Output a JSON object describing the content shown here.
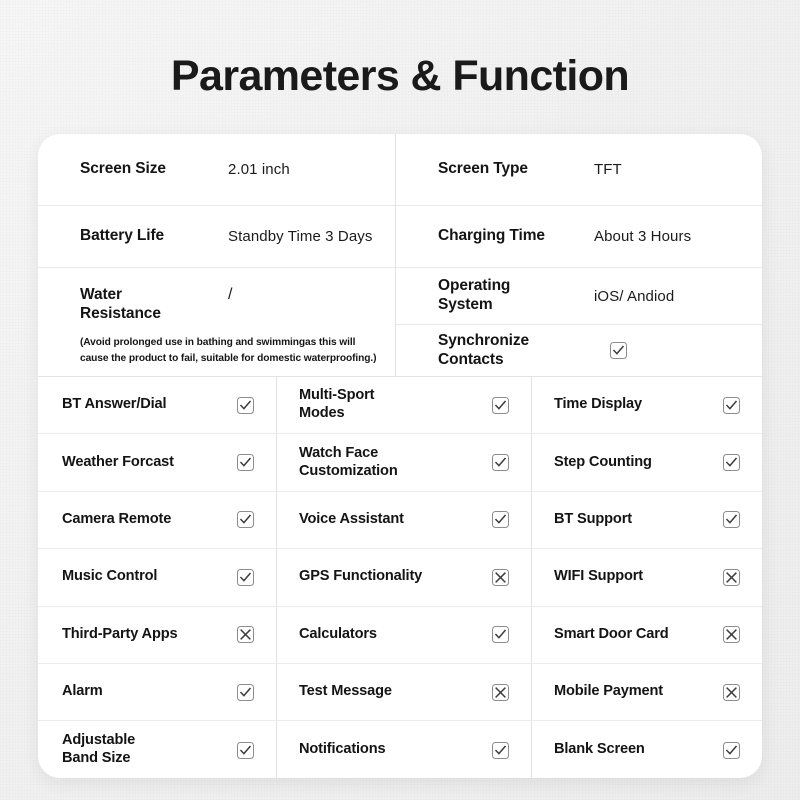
{
  "page": {
    "title": "Parameters & Function",
    "background_color": "#f1f1f1",
    "card_color": "#ffffff"
  },
  "icons": {
    "check": "check-icon",
    "cross": "cross-icon"
  },
  "specs": {
    "left": [
      {
        "label": "Screen Size",
        "value": "2.01 inch"
      },
      {
        "label": "Battery Life",
        "value": "Standby Time 3 Days"
      },
      {
        "label": "Water\nResistance",
        "value": "/",
        "note": "(Avoid prolonged use in bathing and swimmingas this will cause the product to fail, suitable for domestic waterproofing.)"
      }
    ],
    "right": [
      {
        "label": "Screen Type",
        "value": "TFT"
      },
      {
        "label": "Charging Time",
        "value": "About 3 Hours"
      },
      {
        "label": "Operating\nSystem",
        "value": "iOS/ Andiod"
      },
      {
        "label": "Synchronize\nContacts",
        "value": "check"
      }
    ]
  },
  "features": [
    [
      {
        "label": "BT Answer/Dial",
        "state": "check"
      },
      {
        "label": "Multi-Sport\nModes",
        "state": "check"
      },
      {
        "label": "Time Display",
        "state": "check"
      }
    ],
    [
      {
        "label": "Weather Forcast",
        "state": "check"
      },
      {
        "label": "Watch Face\nCustomization",
        "state": "check"
      },
      {
        "label": "Step Counting",
        "state": "check"
      }
    ],
    [
      {
        "label": "Camera Remote",
        "state": "check"
      },
      {
        "label": "Voice Assistant",
        "state": "check"
      },
      {
        "label": "BT Support",
        "state": "check"
      }
    ],
    [
      {
        "label": "Music Control",
        "state": "check"
      },
      {
        "label": "GPS Functionality",
        "state": "cross"
      },
      {
        "label": "WIFI Support",
        "state": "cross"
      }
    ],
    [
      {
        "label": "Third-Party Apps",
        "state": "cross"
      },
      {
        "label": "Calculators",
        "state": "check"
      },
      {
        "label": "Smart Door Card",
        "state": "cross"
      }
    ],
    [
      {
        "label": "Alarm",
        "state": "check"
      },
      {
        "label": "Test Message",
        "state": "cross"
      },
      {
        "label": "Mobile Payment",
        "state": "cross"
      }
    ],
    [
      {
        "label": "Adjustable\nBand Size",
        "state": "check"
      },
      {
        "label": "Notifications",
        "state": "check"
      },
      {
        "label": "Blank Screen",
        "state": "check"
      }
    ]
  ]
}
